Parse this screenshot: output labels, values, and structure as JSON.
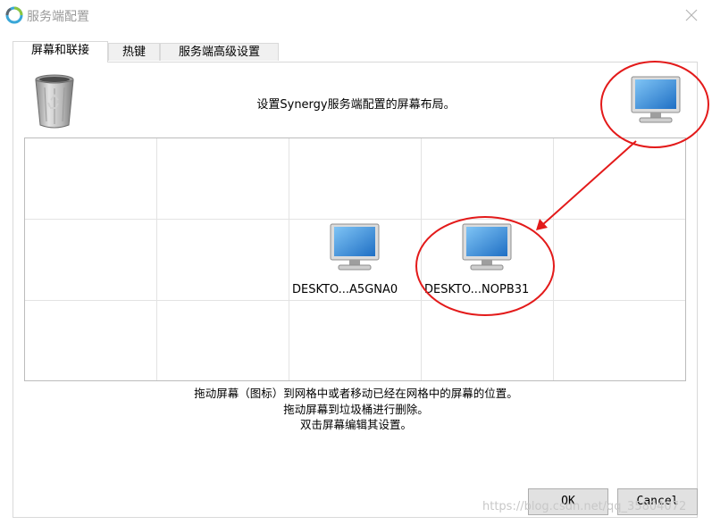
{
  "window": {
    "title": "服务端配置"
  },
  "tabs": [
    {
      "label": "屏幕和联接",
      "active": true
    },
    {
      "label": "热键",
      "active": false
    },
    {
      "label": "服务端高级设置",
      "active": false
    }
  ],
  "layout_instruction": "设置Synergy服务端配置的屏幕布局。",
  "screens": [
    {
      "name": "DESKTO...A5GNA0"
    },
    {
      "name": "DESKTO...NOPB31"
    }
  ],
  "help_lines": [
    "拖动屏幕（图标）到网格中或者移动已经在网格中的屏幕的位置。",
    "拖动屏幕到垃圾桶进行删除。",
    "双击屏幕编辑其设置。"
  ],
  "buttons": {
    "ok": "OK",
    "cancel": "Cancel"
  },
  "watermark": "https://blog.csdn.net/qq_35804072",
  "icons": {
    "trash": "trash-can-icon",
    "new_screen": "monitor-icon",
    "close": "close-icon",
    "app": "synergy-app-icon"
  },
  "colors": {
    "annotation": "#e31a1a",
    "monitor_screen": "#2f8fe0"
  }
}
